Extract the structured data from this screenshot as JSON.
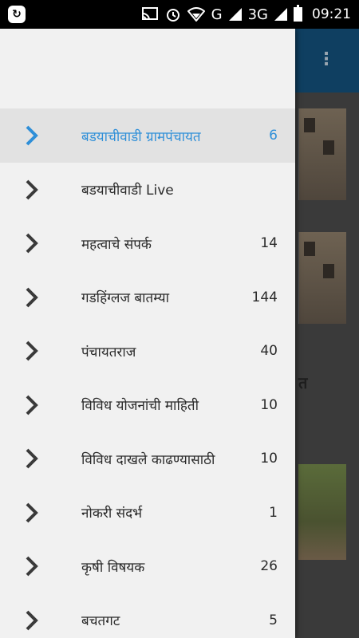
{
  "status_bar": {
    "network_text": "G",
    "network_text_2": "3G",
    "time": "09:21",
    "icons": [
      "app-notification-icon",
      "cast-icon",
      "alarm-icon",
      "wifi-icon",
      "signal-icon",
      "battery-icon"
    ]
  },
  "drawer": {
    "items": [
      {
        "label": "बडयाचीवाडी ग्रामपंचायत",
        "count": "6",
        "active": true
      },
      {
        "label": "बडयाचीवाडी Live",
        "count": ""
      },
      {
        "label": "महत्वाचे संपर्क",
        "count": "14"
      },
      {
        "label": "गडहिंग्लज बातम्या",
        "count": "144"
      },
      {
        "label": "पंचायतराज",
        "count": "40"
      },
      {
        "label": "विविध योजनांची माहिती",
        "count": "10"
      },
      {
        "label": "विविध दाखले काढण्यासाठी",
        "count": "10"
      },
      {
        "label": "नोकरी संदर्भ",
        "count": "1"
      },
      {
        "label": "कृषी विषयक",
        "count": "26"
      },
      {
        "label": "बचतगट",
        "count": "5"
      }
    ]
  },
  "background": {
    "partial_text": "त"
  },
  "colors": {
    "accent": "#2f8fd8",
    "toolbar": "#0f3f61",
    "drawer_bg": "#f1f1f1"
  }
}
